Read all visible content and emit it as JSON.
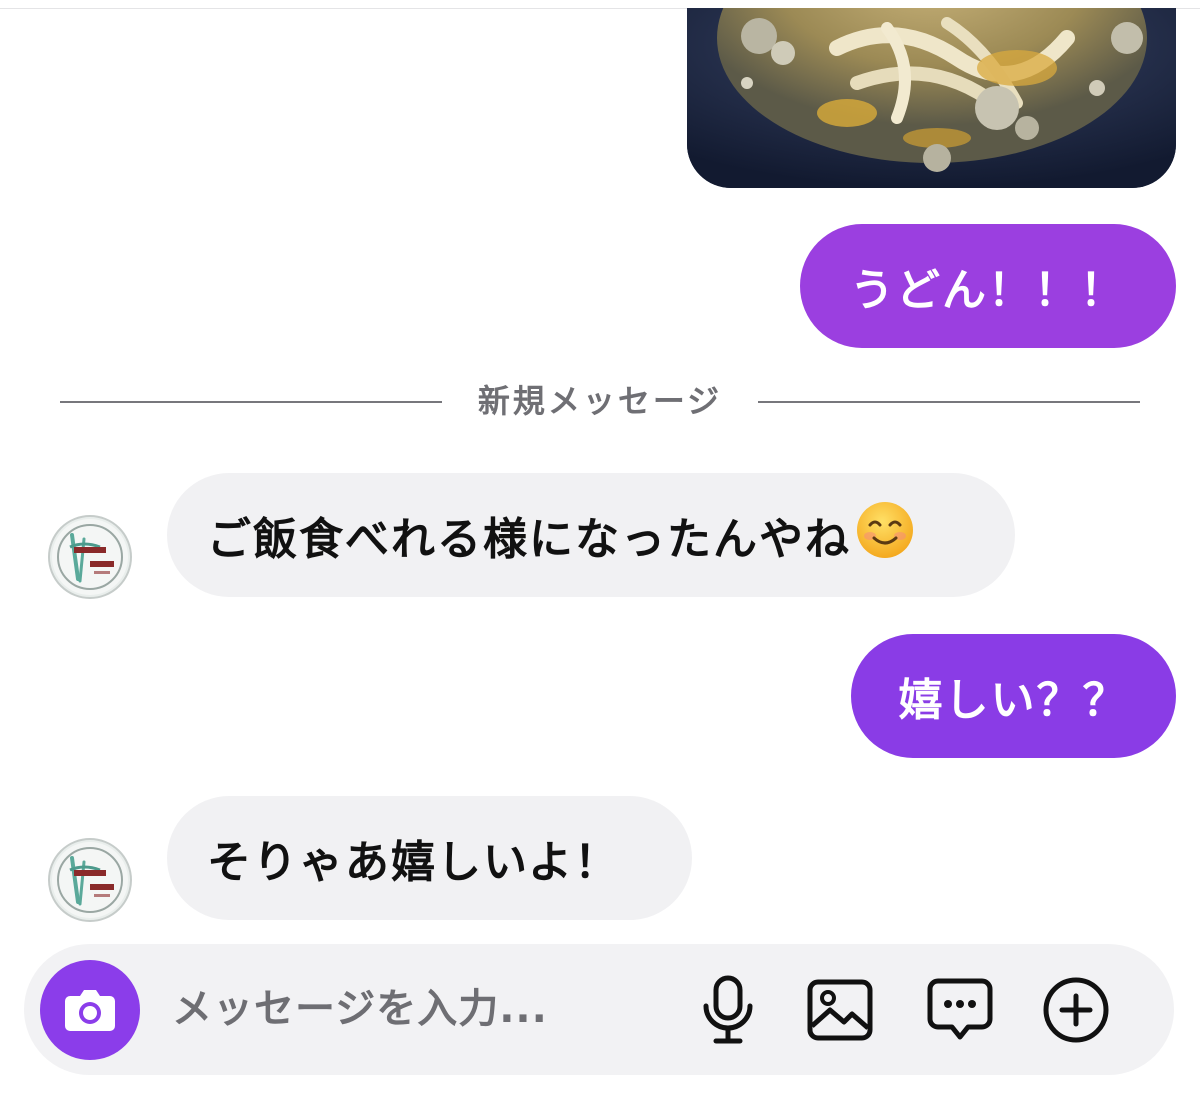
{
  "messages": {
    "outgoing_1": "うどん！！！",
    "divider_label": "新規メッセージ",
    "incoming_1": "ご飯食べれる様になったんやね",
    "incoming_1_emoji": "smiling-face-emoji",
    "outgoing_2": "嬉しい？？",
    "incoming_2": "そりゃあ嬉しいよ！"
  },
  "composer": {
    "placeholder": "メッセージを入力...",
    "value": "",
    "icons": [
      "camera-icon",
      "microphone-icon",
      "image-icon",
      "sticker-icon",
      "plus-circle-icon"
    ]
  },
  "colors": {
    "outgoing_bubble_1": "#9b3fe0",
    "outgoing_bubble_2": "#8a3ce6",
    "incoming_bubble": "#f1f1f3",
    "accent": "#8b3dea"
  }
}
